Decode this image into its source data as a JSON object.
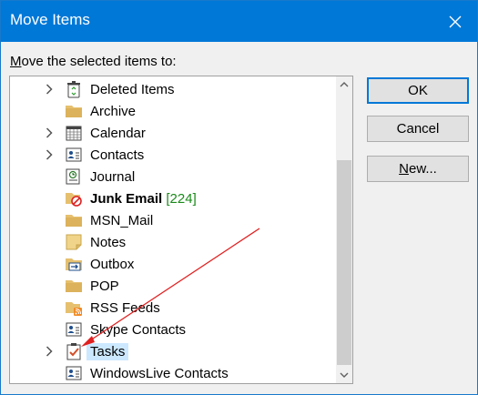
{
  "dialog": {
    "title": "Move Items",
    "prompt_underlined": "M",
    "prompt_rest": "ove the selected items to:"
  },
  "buttons": {
    "ok": "OK",
    "cancel": "Cancel",
    "new_underlined": "N",
    "new_rest": "ew..."
  },
  "folders": [
    {
      "label": "Deleted Items",
      "expandable": true,
      "icon": "recycle-bin-icon"
    },
    {
      "label": "Archive",
      "expandable": false,
      "icon": "folder-icon"
    },
    {
      "label": "Calendar",
      "expandable": true,
      "icon": "calendar-icon"
    },
    {
      "label": "Contacts",
      "expandable": true,
      "icon": "contacts-icon"
    },
    {
      "label": "Journal",
      "expandable": false,
      "icon": "journal-icon"
    },
    {
      "label": "Junk Email",
      "count": "[224]",
      "bold": true,
      "expandable": false,
      "icon": "junk-email-icon"
    },
    {
      "label": "MSN_Mail",
      "expandable": false,
      "icon": "folder-icon"
    },
    {
      "label": "Notes",
      "expandable": false,
      "icon": "notes-icon"
    },
    {
      "label": "Outbox",
      "expandable": false,
      "icon": "outbox-icon"
    },
    {
      "label": "POP",
      "expandable": false,
      "icon": "folder-icon"
    },
    {
      "label": "RSS Feeds",
      "expandable": false,
      "icon": "rss-folder-icon"
    },
    {
      "label": "Skype Contacts",
      "expandable": false,
      "icon": "contacts-icon"
    },
    {
      "label": "Tasks",
      "expandable": true,
      "selected": true,
      "icon": "tasks-icon"
    },
    {
      "label": "WindowsLive Contacts",
      "expandable": false,
      "icon": "contacts-icon"
    }
  ],
  "colors": {
    "titlebar": "#0078d7",
    "selection": "#cce8ff",
    "unread_count": "#1a8a1a",
    "annotation_arrow": "#e02020"
  }
}
